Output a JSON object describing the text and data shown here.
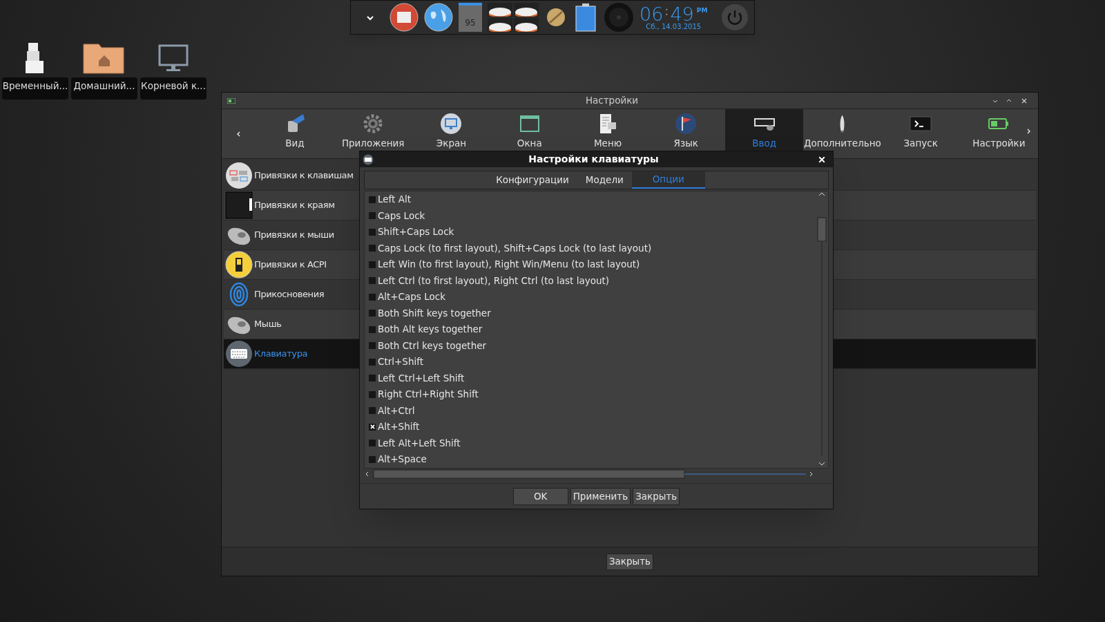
{
  "dock": {
    "badge": "95",
    "clock": {
      "hours": "06",
      "separator": ":",
      "minutes": "49",
      "ampm": "PM",
      "date": "Сб., 14.03.2015"
    }
  },
  "desktop_icons": [
    {
      "label": "Временный...",
      "kind": "boxes"
    },
    {
      "label": "Домашний...",
      "kind": "home"
    },
    {
      "label": "Корневой к...",
      "kind": "monitor"
    }
  ],
  "window": {
    "title": "Настройки",
    "tabs": [
      {
        "label": "Вид",
        "kind": "view",
        "selected": false
      },
      {
        "label": "Приложения",
        "kind": "gear",
        "selected": false
      },
      {
        "label": "Экран",
        "kind": "screen",
        "selected": false
      },
      {
        "label": "Окна",
        "kind": "window",
        "selected": false
      },
      {
        "label": "Меню",
        "kind": "menu",
        "selected": false
      },
      {
        "label": "Язык",
        "kind": "flag",
        "selected": false
      },
      {
        "label": "Ввод",
        "kind": "keyboard",
        "selected": true
      },
      {
        "label": "Дополнительно",
        "kind": "rocket",
        "selected": false
      },
      {
        "label": "Запуск",
        "kind": "terminal",
        "selected": false
      },
      {
        "label": "Настройки",
        "kind": "battery",
        "selected": false
      }
    ],
    "sidebar": [
      {
        "label": "Привязки к клавишам",
        "kind": "keys",
        "selected": false
      },
      {
        "label": "Привязки к краям",
        "kind": "edge",
        "selected": false
      },
      {
        "label": "Привязки к мыши",
        "kind": "mouse",
        "selected": false
      },
      {
        "label": "Привязки к ACPI",
        "kind": "acpi",
        "selected": false
      },
      {
        "label": "Прикосновения",
        "kind": "finger",
        "selected": false
      },
      {
        "label": "Мышь",
        "kind": "mouse",
        "selected": false
      },
      {
        "label": "Клавиатура",
        "kind": "kbd",
        "selected": true
      }
    ],
    "close_button": "Закрыть"
  },
  "dialog": {
    "title": "Настройки клавиатуры",
    "tabs": [
      {
        "label": "Конфигурации",
        "selected": false
      },
      {
        "label": "Модели",
        "selected": false
      },
      {
        "label": "Опции",
        "selected": true
      }
    ],
    "options": [
      {
        "label": "Left Alt",
        "checked": false
      },
      {
        "label": "Caps Lock",
        "checked": false
      },
      {
        "label": "Shift+Caps Lock",
        "checked": false
      },
      {
        "label": "Caps Lock (to first layout), Shift+Caps Lock (to last layout)",
        "checked": false
      },
      {
        "label": "Left Win (to first layout), Right Win/Menu (to last layout)",
        "checked": false
      },
      {
        "label": "Left Ctrl (to first layout), Right Ctrl (to last layout)",
        "checked": false
      },
      {
        "label": "Alt+Caps Lock",
        "checked": false
      },
      {
        "label": "Both Shift keys together",
        "checked": false
      },
      {
        "label": "Both Alt keys together",
        "checked": false
      },
      {
        "label": "Both Ctrl keys together",
        "checked": false
      },
      {
        "label": "Ctrl+Shift",
        "checked": false
      },
      {
        "label": "Left Ctrl+Left Shift",
        "checked": false
      },
      {
        "label": "Right Ctrl+Right Shift",
        "checked": false
      },
      {
        "label": "Alt+Ctrl",
        "checked": false
      },
      {
        "label": "Alt+Shift",
        "checked": true
      },
      {
        "label": "Left Alt+Left Shift",
        "checked": false
      },
      {
        "label": "Alt+Space",
        "checked": false
      }
    ],
    "buttons": [
      "OK",
      "Применить",
      "Закрыть"
    ]
  }
}
